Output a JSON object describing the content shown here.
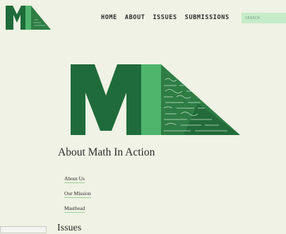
{
  "nav": {
    "home": "HOME",
    "about": "ABOUT",
    "issues": "ISSUES",
    "submissions": "SUBMISSIONS"
  },
  "search": {
    "placeholder": "SEARCH"
  },
  "page": {
    "title": "About Math In Action"
  },
  "about_links": [
    {
      "label": "About Us"
    },
    {
      "label": "Our Mission"
    },
    {
      "label": "Masthead"
    }
  ],
  "issues_section": {
    "heading": "Issues"
  },
  "colors": {
    "background": "#eff2e4",
    "dark_green": "#1f6b3b",
    "mid_green": "#2e7d45",
    "light_green": "#4fb56d",
    "search_bg": "#c5ecc9",
    "link_underline": "#9ccf9f"
  }
}
